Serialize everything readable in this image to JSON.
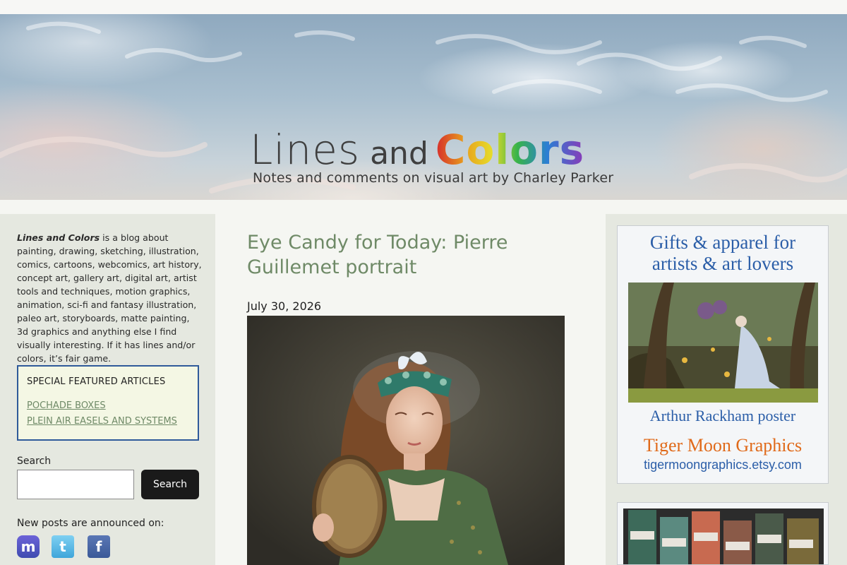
{
  "site": {
    "title_lines": "Lines",
    "title_and": "and",
    "title_colors": "Colors",
    "tagline": "Notes and comments on visual art by Charley Parker"
  },
  "sidebar": {
    "about_name": "Lines and Colors",
    "about_text": " is a blog about painting, drawing, sketching, illustration, comics, cartoons, webcomics, art history, concept art, gallery art, digital art, artist tools and techniques, motion graphics, animation, sci-fi and fantasy illustration, paleo art, storyboards, matte painting, 3d graphics and anything else I find visually interesting. If it has lines and/or colors, it’s fair game.",
    "featured": {
      "heading": "SPECIAL FEATURED ARTICLES",
      "links": [
        "POCHADE BOXES",
        "PLEIN AIR EASELS AND SYSTEMS"
      ]
    },
    "search": {
      "label": "Search",
      "placeholder": "",
      "button": "Search"
    },
    "announce": "New posts are announced on:",
    "social_icons": [
      "mastodon-icon",
      "twitter-icon",
      "facebook-icon"
    ]
  },
  "post": {
    "title": "Eye Candy for Today: Pierre Guillemet portrait",
    "date": "July 30, 2026"
  },
  "ad": {
    "headline_line1": "Gifts & apparel for",
    "headline_line2": "artists & art lovers",
    "caption": "Arthur Rackham poster",
    "brand": "Tiger Moon Graphics",
    "url": "tigermoongraphics.etsy.com"
  },
  "colors": {
    "accent_green": "#6f8a67",
    "sidebar_bg": "#e5e8e0",
    "featured_border": "#2f5a9a",
    "ad_blue": "#2b5ea8",
    "ad_orange": "#e06a1a"
  }
}
